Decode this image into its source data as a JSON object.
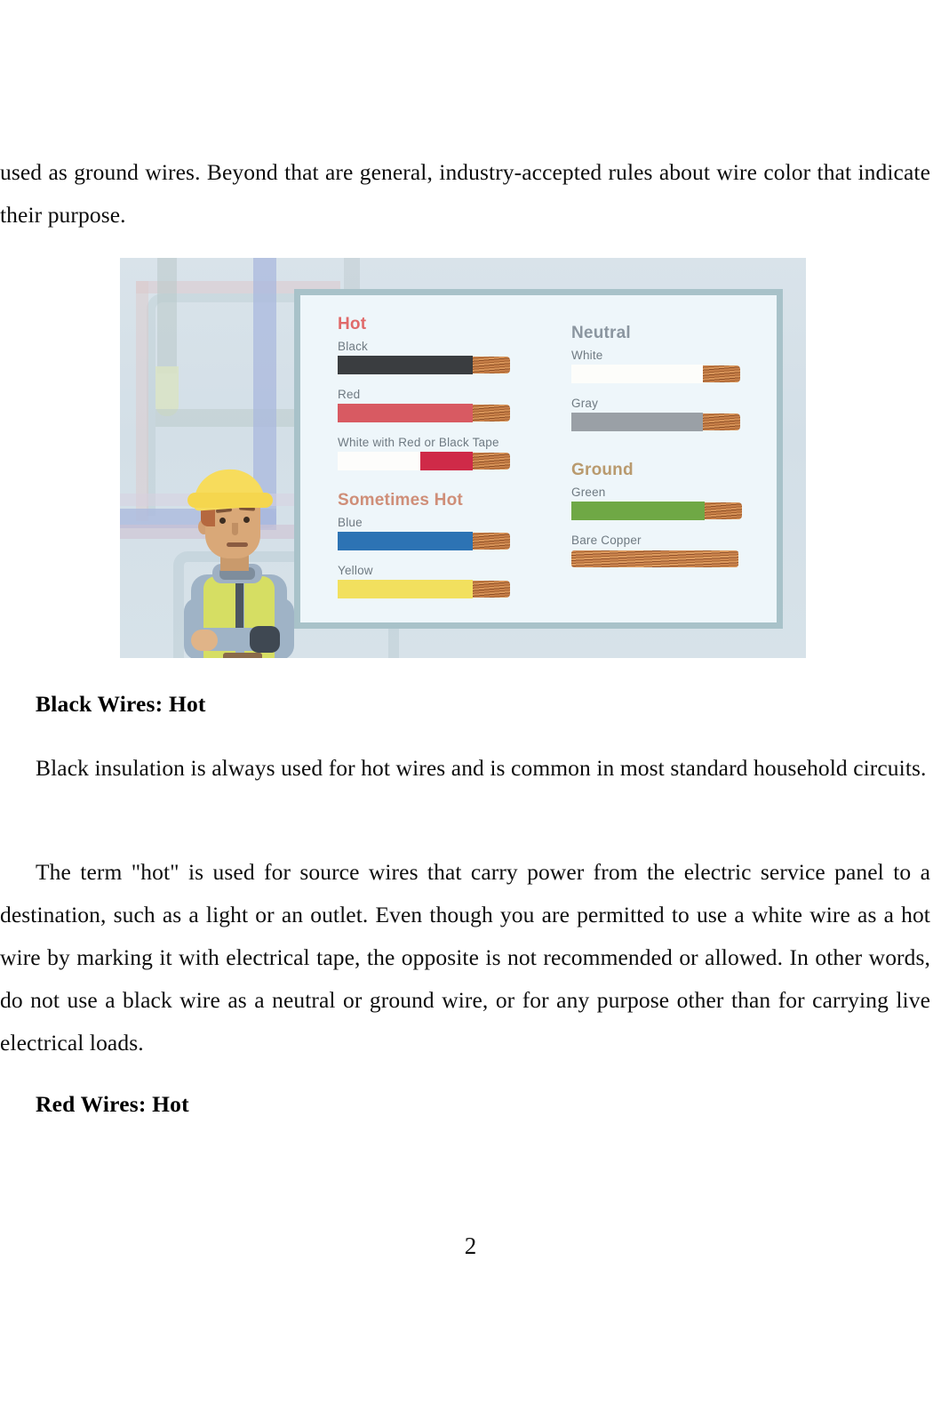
{
  "document": {
    "page_number": "2",
    "paragraphs": {
      "intro": "used as ground wires. Beyond that are general, industry-accepted rules about wire color that indicate their purpose.",
      "black_body_1": "Black insulation is always used for hot wires and is common in most standard household circuits.",
      "black_body_2": "The term \"hot\" is used for source wires that carry power from the electric service panel to a destination, such as a light or an outlet. Even though you are permitted to use a white wire as a hot wire by marking it with electrical tape, the opposite is not recommended or allowed. In other words, do not use a black wire as a neutral or ground wire, or for any purpose other than for carrying live electrical loads."
    },
    "headings": {
      "black_wires": "Black Wires: Hot",
      "red_wires": "Red Wires: Hot"
    }
  },
  "figure": {
    "thought_bubble_symbol": "?",
    "columns": {
      "left": [
        {
          "group": "Hot",
          "group_color": "#e06a6a",
          "wires": [
            {
              "label": "Black",
              "color": "#3a3d40",
              "type": "solid"
            },
            {
              "label": "Red",
              "color": "#d85a62",
              "type": "solid"
            },
            {
              "label": "White with Red or Black Tape",
              "color": "#fdfdfb",
              "tape_color": "#cf2a48",
              "type": "taped"
            }
          ]
        },
        {
          "group": "Sometimes Hot",
          "group_color": "#cf8e78",
          "wires": [
            {
              "label": "Blue",
              "color": "#2d73b4",
              "type": "solid"
            },
            {
              "label": "Yellow",
              "color": "#f2e05e",
              "type": "solid"
            }
          ]
        }
      ],
      "right": [
        {
          "group": "Neutral",
          "group_color": "#8b96a0",
          "wires": [
            {
              "label": "White",
              "color": "#fdfdfa",
              "type": "solid"
            },
            {
              "label": "Gray",
              "color": "#9aa0a6",
              "type": "solid"
            }
          ]
        },
        {
          "group": "Ground",
          "group_color": "#b99a6e",
          "wires": [
            {
              "label": "Green",
              "color": "#6fa845",
              "type": "solid"
            },
            {
              "label": "Bare Copper",
              "color": "#c9814a",
              "type": "copper"
            }
          ]
        }
      ]
    }
  }
}
